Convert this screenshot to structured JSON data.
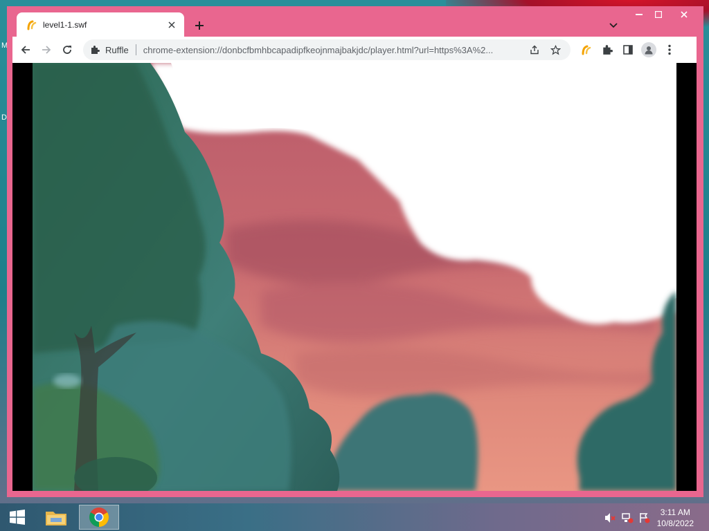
{
  "desktop": {
    "edge_letters": [
      "M",
      "D"
    ]
  },
  "browser": {
    "tab": {
      "title": "level1-1.swf",
      "favicon": "ruffle-icon"
    },
    "toolbar": {
      "extension_name": "Ruffle",
      "url": "chrome-extension://donbcfbmhbcapadipfkeojnmajbakjdc/player.html?url=https%3A%2..."
    },
    "content": {
      "description_type": "flash-game-scene"
    }
  },
  "taskbar": {
    "items": [
      "file-explorer-icon",
      "chrome-icon"
    ],
    "clock": {
      "time": "3:11 AM",
      "date": "10/8/2022"
    }
  },
  "colors": {
    "window_frame": "#e9668f",
    "sky_pink": "#c96a72",
    "foliage": "#3c7c72"
  }
}
